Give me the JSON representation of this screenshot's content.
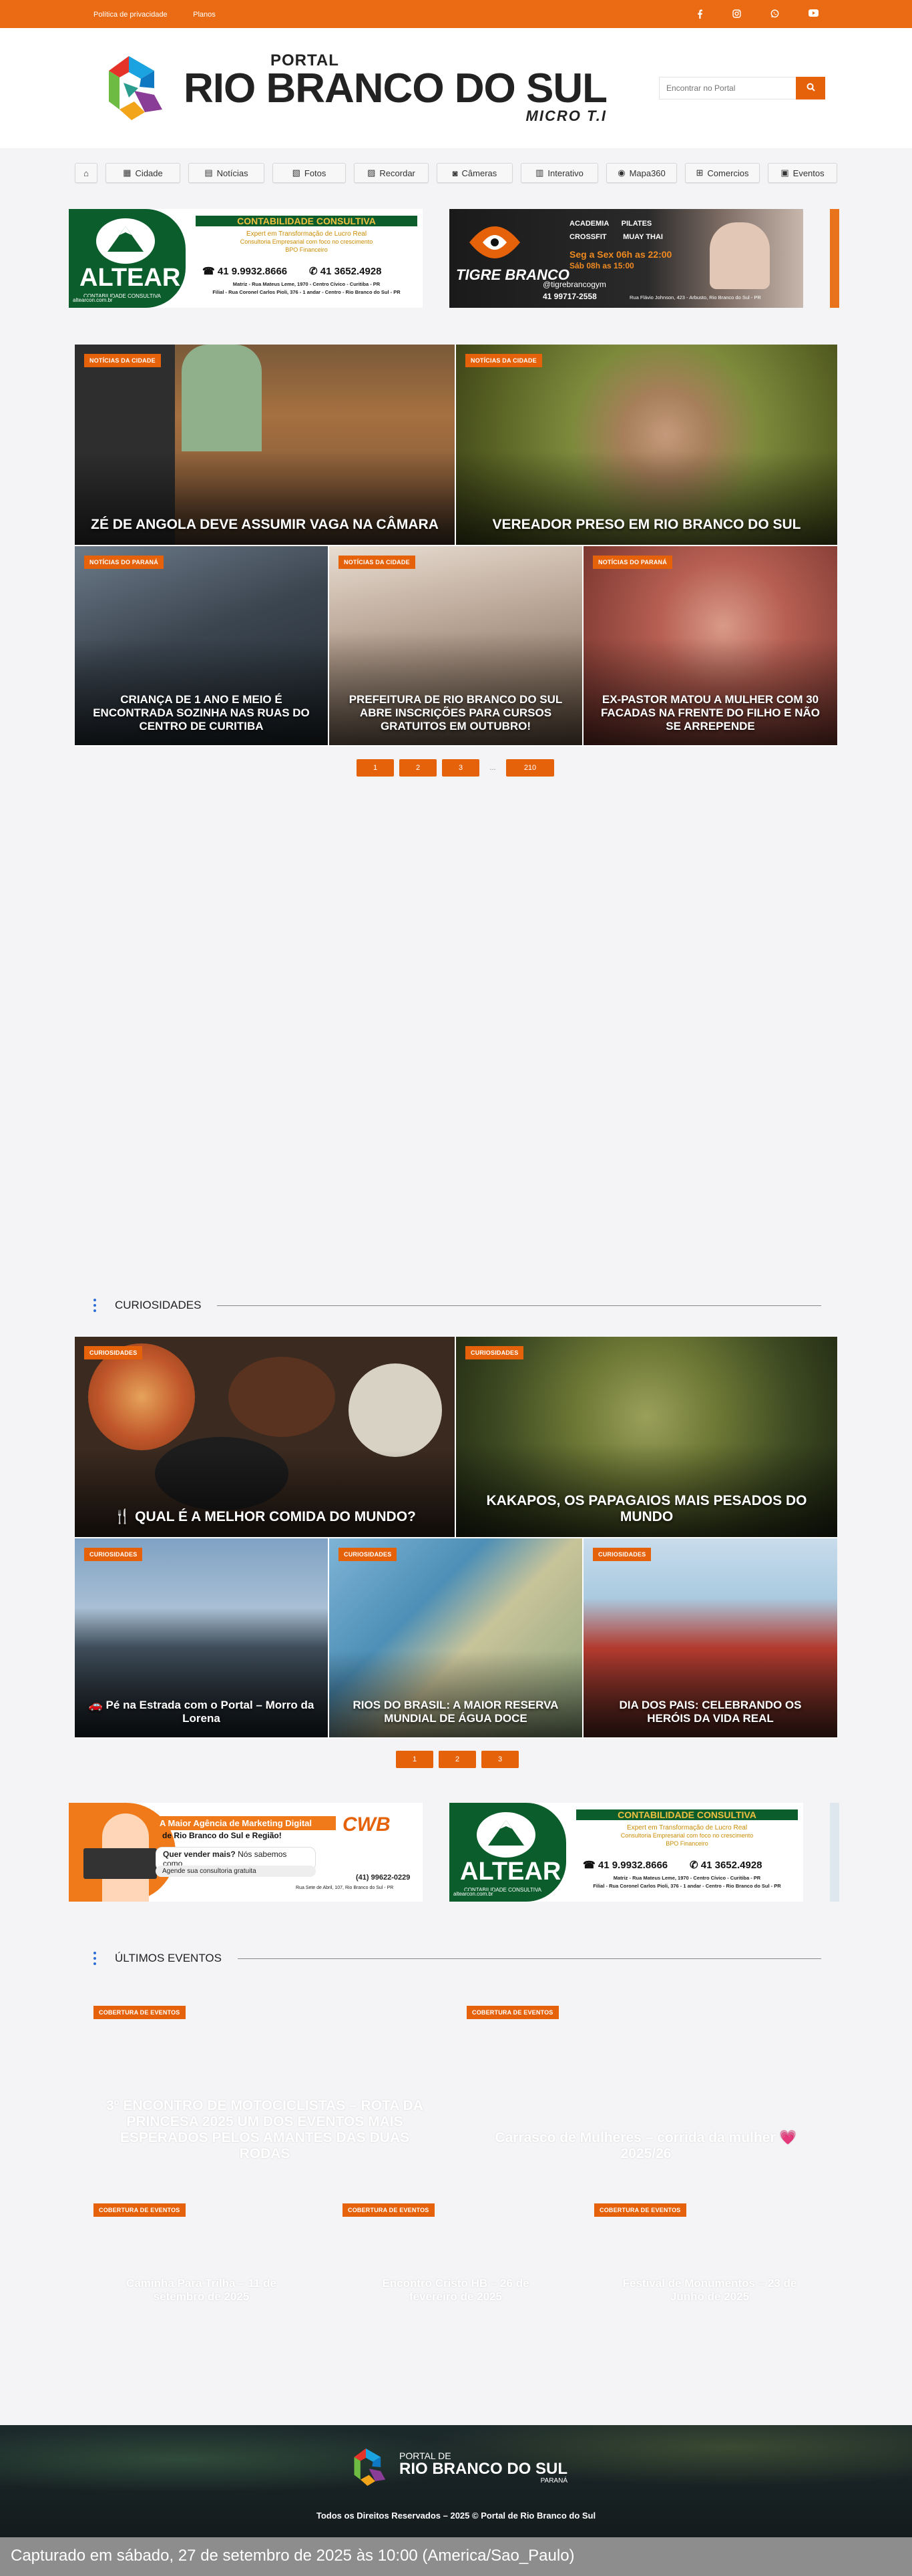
{
  "topbar": {
    "links": [
      "Política de privacidade",
      "Planos"
    ],
    "social_icons": [
      "facebook-icon",
      "instagram-icon",
      "whatsapp-icon",
      "youtube-icon"
    ]
  },
  "header": {
    "logo_line1": "PORTAL",
    "logo_line2": "RIO BRANCO DO SUL",
    "logo_line3": "MICRO T.I",
    "search_placeholder": "Encontrar no Portal"
  },
  "nav": {
    "items": [
      {
        "label": "",
        "icon": "home-icon"
      },
      {
        "label": "Cidade",
        "icon": "building-icon"
      },
      {
        "label": "Notícias",
        "icon": "newspaper-icon"
      },
      {
        "label": "Fotos",
        "icon": "images-icon"
      },
      {
        "label": "Recordar",
        "icon": "photo-icon"
      },
      {
        "label": "Câmeras",
        "icon": "camera-icon"
      },
      {
        "label": "Interativo",
        "icon": "chart-icon"
      },
      {
        "label": "Mapa360",
        "icon": "map-pin-icon"
      },
      {
        "label": "Comercios",
        "icon": "cart-icon"
      },
      {
        "label": "Eventos",
        "icon": "book-icon"
      }
    ]
  },
  "ads": {
    "altear": {
      "brand": "ALTEAR",
      "sub": "CONTABILIDADE CONSULTIVA",
      "title": "CONTABILIDADE CONSULTIVA",
      "line1": "Expert em Transformação de Lucro Real",
      "line2": "Consultoria Empresarial com foco no crescimento",
      "line3": "BPO Financeiro",
      "phone1": "41 9.9932.8666",
      "phone2": "41 3652.4928",
      "addr1": "Matriz - Rua Mateus Leme, 1970 - Centro Cívico - Curitiba - PR",
      "addr2": "Filial - Rua Coronel Carlos Pioli, 376 - 1 andar - Centro - Rio Branco do Sul - PR",
      "site": "altearcon.com.br"
    },
    "tigre": {
      "brand": "TIGRE BRANCO",
      "tag": "ACADEMIA",
      "acts": [
        "ACADEMIA",
        "PILATES",
        "CROSSFIT",
        "MUAY THAI"
      ],
      "hours1": "Seg a Sex 06h as 22:00",
      "hours2": "Sáb 08h as 15:00",
      "handle": "@tigrebrancogym",
      "phone": "41 99717-2558",
      "addr": "Rua Flávio Johnson, 423 - Arbusto, Rio Branco do Sul - PR"
    },
    "cwb": {
      "brand": "CWB",
      "title": "A Maior Agência de Marketing Digital",
      "title2": "de Rio Branco do Sul e Região!",
      "q": "Quer vender mais?",
      "a": "Nós sabemos como",
      "cta": "Agende sua consultoria gratuita",
      "phone": "(41) 99622-0229",
      "addr": "Rua Sete de Abril, 107, Rio Branco do Sul - PR"
    }
  },
  "news": [
    {
      "tag": "NOTÍCIAS DA CIDADE",
      "title": "ZÉ DE ANGOLA DEVE ASSUMIR VAGA NA CÂMARA"
    },
    {
      "tag": "NOTÍCIAS DA CIDADE",
      "title": "VEREADOR PRESO EM RIO BRANCO DO SUL"
    },
    {
      "tag": "NOTÍCIAS DO PARANÁ",
      "title": "CRIANÇA DE 1 ANO E MEIO É ENCONTRADA SOZINHA NAS RUAS DO CENTRO DE CURITIBA"
    },
    {
      "tag": "NOTÍCIAS DA CIDADE",
      "title": "PREFEITURA DE RIO BRANCO DO SUL ABRE INSCRIÇÕES PARA CURSOS GRATUITOS EM OUTUBRO!"
    },
    {
      "tag": "NOTÍCIAS DO PARANÁ",
      "title": "EX-PASTOR MATOU A MULHER COM 30 FACADAS NA FRENTE DO FILHO E NÃO SE ARREPENDE"
    }
  ],
  "news_pager": [
    "1",
    "2",
    "3",
    "...",
    "210"
  ],
  "curio_section": "CURIOSIDADES",
  "curio": [
    {
      "tag": "CURIOSIDADES",
      "title": "🍴 QUAL É A MELHOR COMIDA DO MUNDO?"
    },
    {
      "tag": "CURIOSIDADES",
      "title": "KAKAPOS, OS PAPAGAIOS MAIS PESADOS DO MUNDO"
    },
    {
      "tag": "CURIOSIDADES",
      "title": "🚗 Pé na Estrada com o Portal – Morro da Lorena"
    },
    {
      "tag": "CURIOSIDADES",
      "title": "RIOS DO BRASIL: A MAIOR RESERVA MUNDIAL DE ÁGUA DOCE"
    },
    {
      "tag": "CURIOSIDADES",
      "title": "DIA DOS PAIS: CELEBRANDO OS HERÓIS DA VIDA REAL"
    }
  ],
  "curio_pager": [
    "1",
    "2",
    "3"
  ],
  "events_section": "ÚLTIMOS EVENTOS",
  "events": [
    {
      "tag": "COBERTURA DE EVENTOS",
      "title": "3º ENCONTRO DE MOTOCICLISTAS – ROTA DA PRINCESA 2025 UM DOS EVENTOS MAIS ESPERADOS PELOS AMANTES DAS DUAS RODAS"
    },
    {
      "tag": "COBERTURA DE EVENTOS",
      "title": "Carrasco de Mulheres – corrida da mulher 💗 2025/26"
    },
    {
      "tag": "COBERTURA DE EVENTOS",
      "title": "Caminha Para Trilha – 11 de setembro de 2025"
    },
    {
      "tag": "COBERTURA DE EVENTOS",
      "title": "Encontro Cristo HB – 26 de fevereiro de 2025"
    },
    {
      "tag": "COBERTURA DE EVENTOS",
      "title": "Festival de Monumentos – 23 de Junho de 2025"
    }
  ],
  "footer": {
    "logo1": "PORTAL DE",
    "logo2": "RIO BRANCO DO SUL",
    "logo3": "PARANÁ",
    "copyright": "Todos os Direitos Reservados – 2025 © Portal de Rio Branco do Sul"
  },
  "capture": "Capturado em sábado, 27 de setembro de 2025 às 10:00 (America/Sao_Paulo)"
}
